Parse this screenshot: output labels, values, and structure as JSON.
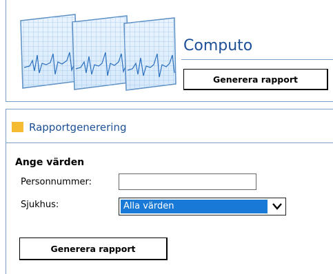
{
  "header": {
    "app_title": "Computo",
    "generate_button_label": "Generera rapport",
    "logo_icon": "waveform-monitors-icon"
  },
  "section": {
    "title": "Rapportgenerering",
    "accent_color": "#f5bb33"
  },
  "form": {
    "heading": "Ange värden",
    "personnummer_label": "Personnummer:",
    "personnummer_value": "",
    "sjukhus_label": "Sjukhus:",
    "sjukhus_selected": "Alla värden",
    "submit_label": "Generera rapport"
  },
  "colors": {
    "title_blue": "#1c4f96",
    "border_blue": "#7aa0c8",
    "select_highlight": "#1979d6"
  }
}
